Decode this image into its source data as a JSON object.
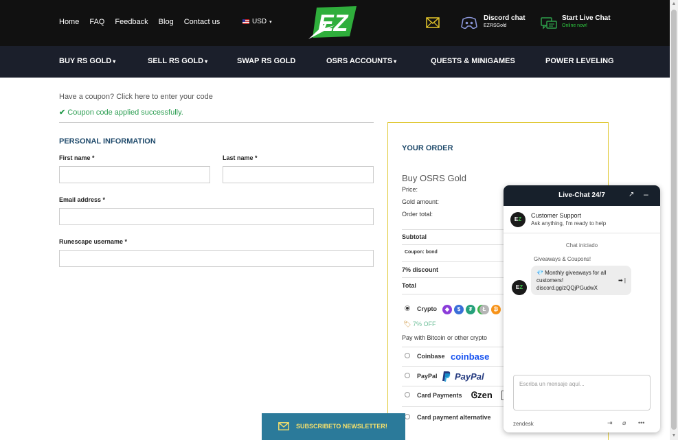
{
  "header": {
    "nav": [
      "Home",
      "FAQ",
      "Feedback",
      "Blog",
      "Contact us"
    ],
    "currency": "USD",
    "logo_text": "EZ",
    "discord_title": "Discord chat",
    "discord_sub": "EZRSGold",
    "live_title": "Start Live Chat",
    "live_sub": "Online now!"
  },
  "mainnav": {
    "items": [
      {
        "label": "BUY RS GOLD",
        "dropdown": true
      },
      {
        "label": "SELL RS GOLD",
        "dropdown": true
      },
      {
        "label": "SWAP RS GOLD",
        "dropdown": false
      },
      {
        "label": "OSRS ACCOUNTS",
        "dropdown": true
      },
      {
        "label": "QUESTS & MINIGAMES",
        "dropdown": false
      },
      {
        "label": "POWER LEVELING",
        "dropdown": false
      }
    ]
  },
  "coupon": {
    "question": "Have a coupon?",
    "link": "Click here to enter your code",
    "success": "Coupon code applied successfully."
  },
  "form": {
    "title": "PERSONAL INFORMATION",
    "first_name": "First name *",
    "last_name": "Last name *",
    "email": "Email address *",
    "username": "Runescape username *"
  },
  "order": {
    "title": "YOUR ORDER",
    "product": "Buy OSRS Gold",
    "price": "Price:",
    "gold_amount": "Gold amount:",
    "order_total": "Order total:",
    "subtotal": "Subtotal",
    "coupon": "Coupon: bond",
    "discount": "7% discount",
    "total": "Total",
    "payments": {
      "crypto": "Crypto",
      "crypto_discount": "7% OFF",
      "crypto_desc": "Pay with Bitcoin or other crypto",
      "coinbase": "Coinbase",
      "coinbase_logo": "coinbase",
      "paypal": "PayPal",
      "paypal_logo": "PayPal",
      "card": "Card Payments",
      "zen_logo": "zen",
      "card_alt": "Card payment alternative"
    }
  },
  "chat": {
    "title": "Live-Chat 24/7",
    "agent_name": "Customer Support",
    "agent_sub": "Ask anything, I'm ready to help",
    "status": "Chat iniciado",
    "giveaway_label": "Giveaways & Coupons!",
    "bubble_line1": "💎 Monthly giveaways for all",
    "bubble_line2": "customers!",
    "bubble_arrow": "➡ |",
    "bubble_link": "discord.gg/zQQjPGudwX",
    "input_placeholder": "Escriba un mensaje aquí...",
    "footer": "zendesk"
  },
  "newsletter": {
    "label": "SUBSCRIBETO NEWSLETTER!"
  },
  "colors": {
    "topbar": "#111111",
    "mainnav": "#1b1f2b",
    "accent_blue": "#1f4a6b",
    "success_green": "#2a9d50",
    "order_border": "#e0c834",
    "newsletter_bg": "#2b7a9a",
    "newsletter_text": "#f7e16b"
  }
}
